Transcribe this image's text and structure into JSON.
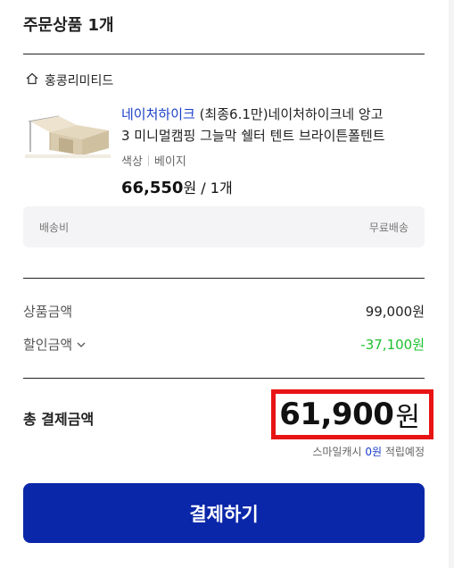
{
  "header": {
    "title": "주문상품 1개"
  },
  "seller": {
    "name": "홍콩리미티드",
    "icon": "home-icon"
  },
  "product": {
    "brand": "네이처하이크",
    "title_rest": " (최종6.1만)네이처하이크네 앙고",
    "title_line2": "3 미니멀캠핑 그늘막 쉘터 텐트 브라이튼폴텐트",
    "option_label": "색상",
    "option_value": "베이지",
    "price": "66,550",
    "price_unit": "원",
    "qty": " / 1개"
  },
  "shipping": {
    "label": "배송비",
    "value": "무료배송"
  },
  "summary": {
    "goods_label": "상품금액",
    "goods_value": "99,000원",
    "discount_label": "할인금액",
    "discount_value": "-37,100원"
  },
  "total": {
    "label": "총 결제금액",
    "amount": "61,900",
    "unit": "원",
    "highlight_color": "#e81414"
  },
  "cash": {
    "prefix": "스마일캐시 ",
    "amount": "0원",
    "suffix": " 적립예정"
  },
  "pay_button": {
    "label": "결제하기",
    "color": "#0a27a9"
  }
}
